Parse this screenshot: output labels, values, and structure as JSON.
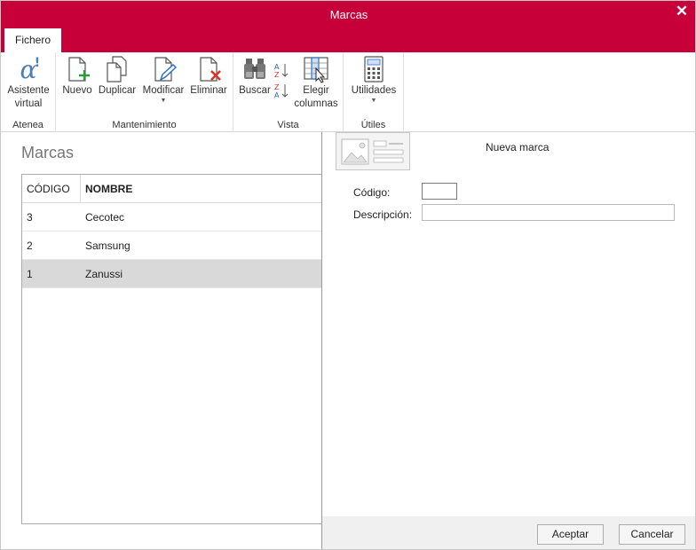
{
  "window": {
    "title": "Marcas",
    "close_glyph": "✕"
  },
  "ribbon": {
    "tab": "Fichero",
    "groups": [
      {
        "label": "Atenea",
        "buttons": [
          {
            "label": "Asistente virtual",
            "line1": "Asistente",
            "line2": "virtual",
            "icon": "alpha-assistant-icon"
          }
        ]
      },
      {
        "label": "Mantenimiento",
        "buttons": [
          {
            "label": "Nuevo",
            "icon": "new-document-icon"
          },
          {
            "label": "Duplicar",
            "icon": "duplicate-icon"
          },
          {
            "label": "Modificar",
            "icon": "edit-document-icon",
            "dropdown": true
          },
          {
            "label": "Eliminar",
            "icon": "delete-document-icon"
          }
        ]
      },
      {
        "label": "Vista",
        "buttons": [
          {
            "label": "Buscar",
            "icon": "binoculars-icon"
          },
          {
            "label": "",
            "icon": "sort-az-icon"
          },
          {
            "label": "Elegir columnas",
            "line1": "Elegir",
            "line2": "columnas",
            "icon": "choose-columns-icon"
          }
        ]
      },
      {
        "label": "Útiles",
        "buttons": [
          {
            "label": "Utilidades",
            "icon": "calculator-icon",
            "dropdown": true
          }
        ]
      }
    ]
  },
  "list": {
    "title": "Marcas",
    "columns": [
      "CÓDIGO",
      "NOMBRE"
    ],
    "rows": [
      {
        "code": "3",
        "name": "Cecotec",
        "selected": false
      },
      {
        "code": "2",
        "name": "Samsung",
        "selected": false
      },
      {
        "code": "1",
        "name": "Zanussi",
        "selected": true
      }
    ]
  },
  "form": {
    "title": "Nueva marca",
    "code_label": "Código:",
    "code_value": "",
    "description_label": "Descripción:",
    "description_value": "",
    "ok_label": "Aceptar",
    "cancel_label": "Cancelar"
  },
  "colors": {
    "accent": "#c8003a",
    "selected_row": "#d9d9d9"
  }
}
